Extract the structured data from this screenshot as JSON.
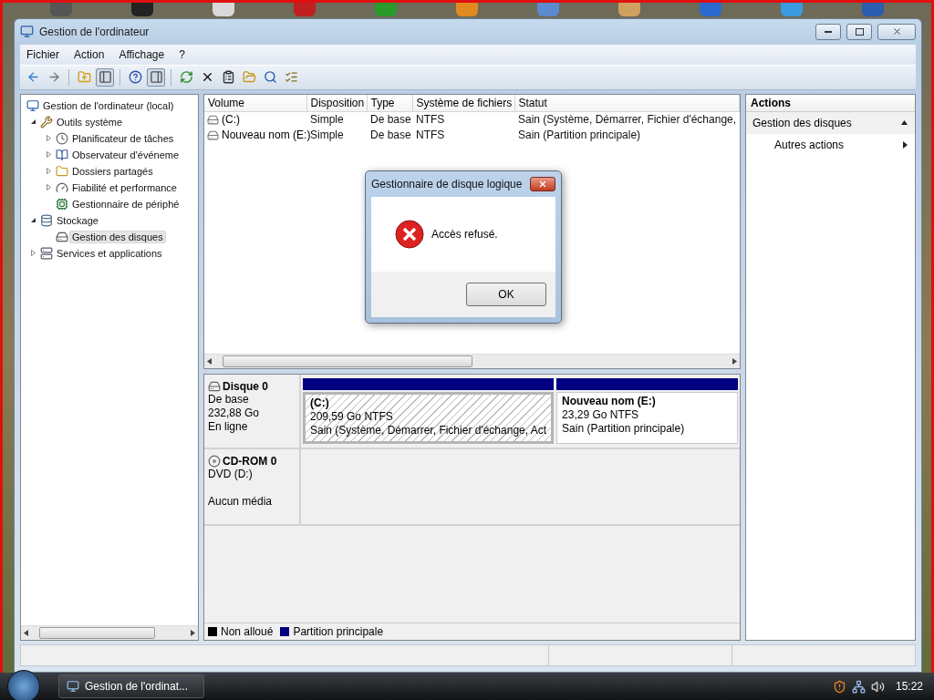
{
  "window": {
    "title": "Gestion de l'ordinateur"
  },
  "menu": [
    "Fichier",
    "Action",
    "Affichage",
    "?"
  ],
  "tree": [
    {
      "label": "Gestion de l'ordinateur (local)",
      "selected": false,
      "children": [
        {
          "label": "Outils système",
          "expanded": true,
          "selected": false,
          "children": [
            {
              "label": "Planificateur de tâches",
              "expanded": false,
              "selected": false
            },
            {
              "label": "Observateur d'événeme",
              "expanded": false,
              "selected": false
            },
            {
              "label": "Dossiers partagés",
              "expanded": false,
              "selected": false
            },
            {
              "label": "Fiabilité et performance",
              "expanded": false,
              "selected": false
            },
            {
              "label": "Gestionnaire de périphé",
              "selected": false
            }
          ]
        },
        {
          "label": "Stockage",
          "expanded": true,
          "selected": false,
          "children": [
            {
              "label": "Gestion des disques",
              "selected": true
            }
          ]
        },
        {
          "label": "Services et applications",
          "expanded": false,
          "selected": false
        }
      ]
    }
  ],
  "table": {
    "columns": [
      "Volume",
      "Disposition",
      "Type",
      "Système de fichiers",
      "Statut"
    ],
    "rows": [
      [
        "(C:)",
        "Simple",
        "De base",
        "NTFS",
        "Sain (Système, Démarrer, Fichier d'échange,"
      ],
      [
        "Nouveau nom (E:)",
        "Simple",
        "De base",
        "NTFS",
        "Sain (Partition principale)"
      ]
    ]
  },
  "disks": [
    {
      "kind": "disk",
      "name": "Disque 0",
      "lines": [
        "De base",
        "232,88 Go",
        "En ligne"
      ],
      "partitions": [
        {
          "name": "(C:)",
          "size": "209,59 Go NTFS",
          "status": "Sain (Système, Démarrer, Fichier d'échange, Act",
          "selected": true,
          "color": "#000080"
        },
        {
          "name": "Nouveau nom  (E:)",
          "size": "23,29 Go NTFS",
          "status": "Sain (Partition principale)",
          "selected": false,
          "color": "#000080"
        }
      ]
    },
    {
      "kind": "cdrom",
      "name": "CD-ROM 0",
      "lines": [
        "DVD (D:)",
        "Aucun média"
      ]
    }
  ],
  "legend": [
    {
      "label": "Non alloué",
      "color": "#000000"
    },
    {
      "label": "Partition principale",
      "color": "#000080"
    }
  ],
  "actions": {
    "title": "Actions",
    "section": {
      "label": "Gestion des disques",
      "expanded": true
    },
    "items": [
      "Autres actions"
    ]
  },
  "dialog": {
    "title": "Gestionnaire de disque logique",
    "message": "Accès refusé.",
    "button": "OK"
  },
  "taskbar": {
    "task": "Gestion de l'ordinat...",
    "clock": "15:22"
  }
}
